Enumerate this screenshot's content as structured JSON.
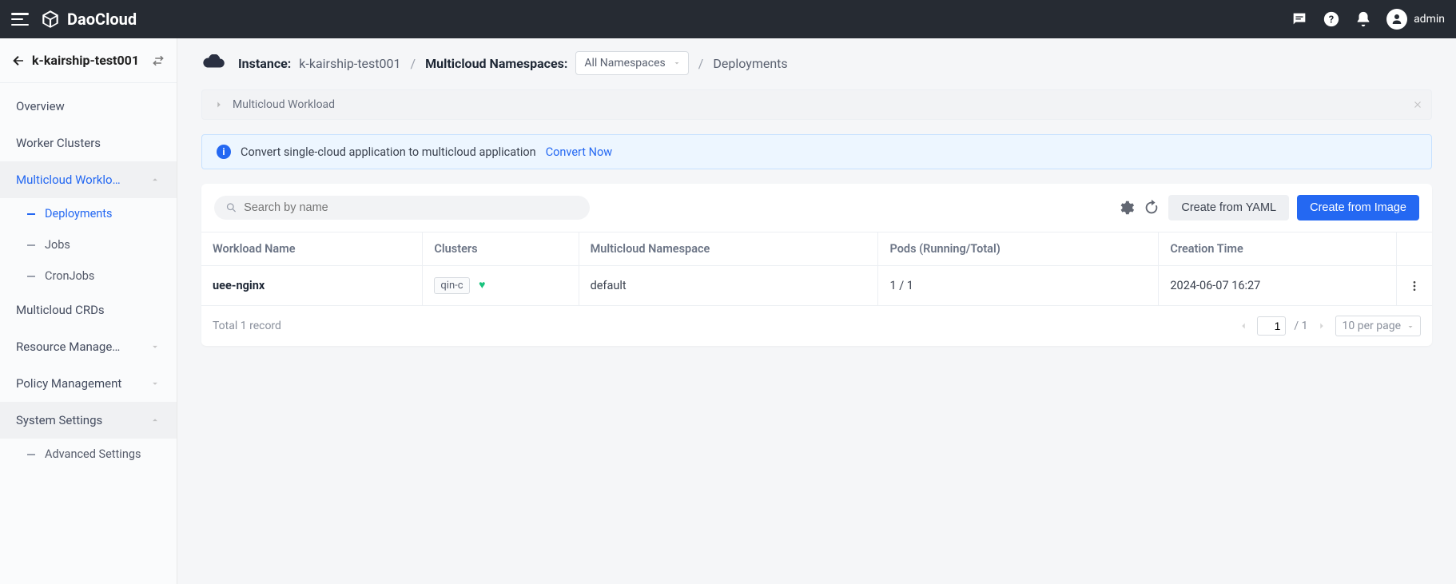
{
  "brand": {
    "name": "DaoCloud"
  },
  "user": {
    "name": "admin"
  },
  "sidebar": {
    "instance_name": "k-kairship-test001",
    "items": [
      {
        "label": "Overview"
      },
      {
        "label": "Worker Clusters"
      },
      {
        "label": "Multicloud Worklo…",
        "expandable": true,
        "active": true
      },
      {
        "label": "Multicloud CRDs"
      },
      {
        "label": "Resource Manage…",
        "expandable": true
      },
      {
        "label": "Policy Management",
        "expandable": true
      },
      {
        "label": "System Settings",
        "expandable": true,
        "expanded": true
      }
    ],
    "workload_children": [
      {
        "label": "Deployments",
        "active": true
      },
      {
        "label": "Jobs"
      },
      {
        "label": "CronJobs"
      }
    ],
    "settings_children": [
      {
        "label": "Advanced Settings"
      }
    ]
  },
  "breadcrumb": {
    "instance_label": "Instance:",
    "instance_value": "k-kairship-test001",
    "ns_label": "Multicloud Namespaces:",
    "ns_selected": "All Namespaces",
    "page": "Deployments"
  },
  "panel_bar": {
    "title": "Multicloud Workload"
  },
  "banner": {
    "text": "Convert single-cloud application to multicloud application",
    "link": "Convert Now"
  },
  "toolbar": {
    "search_placeholder": "Search by name",
    "yaml_btn": "Create from YAML",
    "image_btn": "Create from Image"
  },
  "columns": {
    "name": "Workload Name",
    "clusters": "Clusters",
    "ns": "Multicloud Namespace",
    "pods": "Pods (Running/Total)",
    "created": "Creation Time"
  },
  "rows": [
    {
      "name": "uee-nginx",
      "cluster_tag": "qin-c",
      "namespace": "default",
      "pods": "1 / 1",
      "created": "2024-06-07 16:27"
    }
  ],
  "footer": {
    "total_text": "Total 1 record",
    "page": "1",
    "page_total": "/ 1",
    "per_page": "10 per page"
  }
}
